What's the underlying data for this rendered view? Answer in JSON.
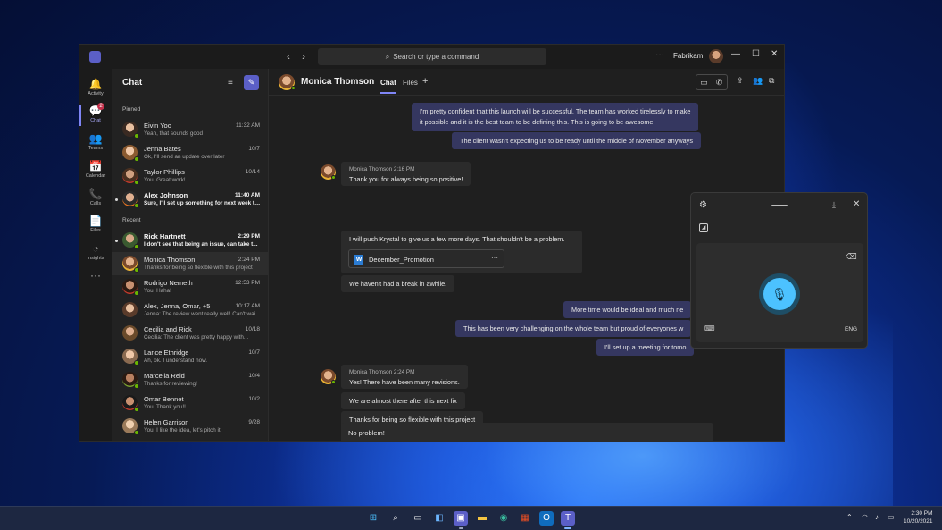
{
  "titlebar": {
    "search_placeholder": "Search or type a command",
    "more": "···",
    "org_name": "Fabrikam",
    "minimize": "—",
    "maximize": "☐",
    "close": "✕"
  },
  "rail": [
    {
      "label": "Activity",
      "icon": "bell-icon",
      "glyph": "🔔"
    },
    {
      "label": "Chat",
      "icon": "chat-icon",
      "glyph": "💬",
      "badge": "2"
    },
    {
      "label": "Teams",
      "icon": "teams-icon",
      "glyph": "👥"
    },
    {
      "label": "Calendar",
      "icon": "calendar-icon",
      "glyph": "📅"
    },
    {
      "label": "Calls",
      "icon": "phone-icon",
      "glyph": "📞"
    },
    {
      "label": "Files",
      "icon": "file-icon",
      "glyph": "📄"
    },
    {
      "label": "Insights",
      "icon": "insights-icon",
      "glyph": "◔"
    },
    {
      "label": "",
      "icon": "more-apps-icon",
      "glyph": "···"
    }
  ],
  "chatlist": {
    "title": "Chat",
    "pinned_label": "Pinned",
    "recent_label": "Recent",
    "pinned": [
      {
        "name": "Eivin Yoo",
        "preview": "Yeah, that sounds good",
        "time": "11:32 AM"
      },
      {
        "name": "Jenna Bates",
        "preview": "Ok, I'll send an update over later",
        "time": "10/7"
      },
      {
        "name": "Taylor Phillips",
        "preview": "You: Great work!",
        "time": "10/14"
      },
      {
        "name": "Alex Johnson",
        "preview": "Sure, I'll set up something for next week to...",
        "time": "11:40 AM",
        "unread": true
      }
    ],
    "recent": [
      {
        "name": "Rick Hartnett",
        "preview": "I don't see that being an issue, can take t...",
        "time": "2:29 PM",
        "unread": true
      },
      {
        "name": "Monica Thomson",
        "preview": "Thanks for being so flexible with this project",
        "time": "2:24 PM",
        "selected": true
      },
      {
        "name": "Rodrigo Nemeth",
        "preview": "You: Haha!",
        "time": "12:53 PM"
      },
      {
        "name": "Alex, Jenna, Omar, +5",
        "preview": "Jenna: The review went really well! Can't wai...",
        "time": "10:17 AM"
      },
      {
        "name": "Cecilia and Rick",
        "preview": "Cecilia: The client was pretty happy with...",
        "time": "10/18"
      },
      {
        "name": "Lance Ethridge",
        "preview": "Ah, ok. I understand now.",
        "time": "10/7"
      },
      {
        "name": "Marcella Reid",
        "preview": "Thanks for reviewing!",
        "time": "10/4"
      },
      {
        "name": "Omar Bennet",
        "preview": "You: Thank you!!",
        "time": "10/2"
      },
      {
        "name": "Helen Garrison",
        "preview": "You: I like the idea, let's pitch it!",
        "time": "9/28"
      }
    ]
  },
  "conversation": {
    "contact_name": "Monica Thomson",
    "tabs": [
      "Chat",
      "Files"
    ],
    "messages": {
      "m1": "I'm pretty confident that this launch will be successful. The team has worked tirelessly to make",
      "m1b": "it possible and it is the best team to be defining this. This is going to be awesome!",
      "m2": "The client wasn't expecting us to be ready until the middle of November anyways",
      "meta1": "Monica Thomson    2:16 PM",
      "m3": "Thank you for always being so positive!",
      "m4": "I will push Krystal to give us a few more days. That shouldn't be a problem.",
      "file_name": "December_Promotion",
      "file_more": "···",
      "m5": "We haven't had a break in awhile.",
      "m6": "More time would be ideal and much ne",
      "m7": "This has been very challenging on the whole team but proud of everyones w",
      "m8": "I'll set up a meeting for tomo",
      "meta2": "Monica Thomson    2:24 PM",
      "m9": "Yes! There have been many revisions.",
      "m10": "We are almost there after this next fix",
      "m11": "Thanks for being so flexible with this project"
    },
    "composer_text": "No problem!"
  },
  "voice_typing": {
    "language": "ENG"
  },
  "taskbar": {
    "time": "2:30 PM",
    "date": "10/20/2021"
  },
  "colors": {
    "accent": "#5b5fc7",
    "mine_bubble": "#353760",
    "mic": "#4cc2ff",
    "presence": "#6bb700"
  }
}
